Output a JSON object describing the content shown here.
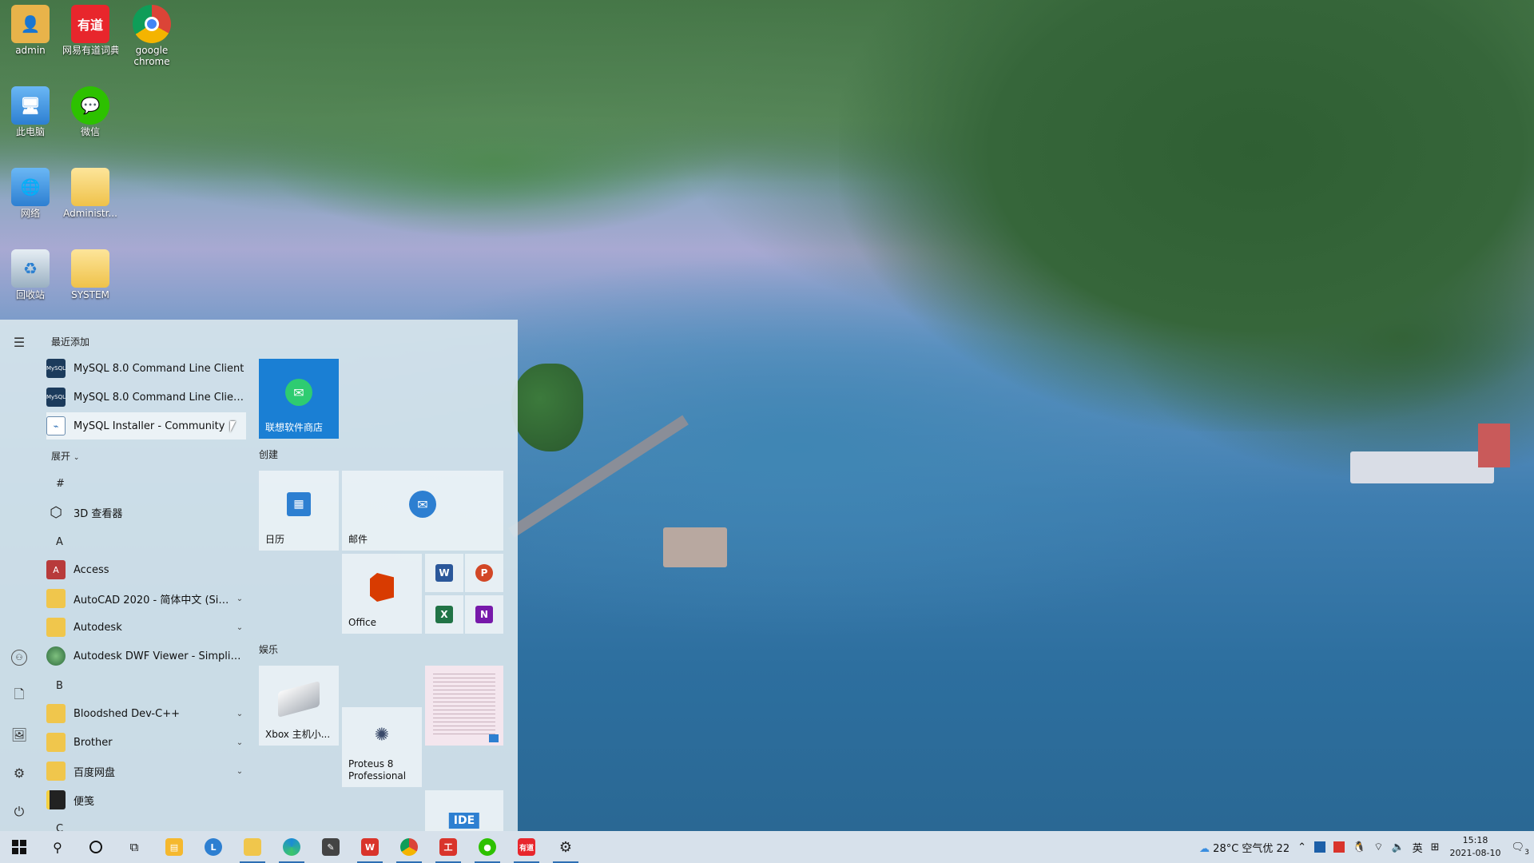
{
  "desktop": {
    "icons": [
      {
        "label": "admin",
        "icon": "user-folder-icon",
        "color": "#e8b34a"
      },
      {
        "label": "网易有道词典",
        "icon": "youdao-icon",
        "color": "#e8262c"
      },
      {
        "label": "google chrome",
        "icon": "chrome-icon",
        "color": "#4285f4"
      },
      {
        "label": "此电脑",
        "icon": "computer-icon",
        "color": "#3a8ee0"
      },
      {
        "label": "微信",
        "icon": "wechat-icon",
        "color": "#2dc100"
      },
      {
        "label": "网络",
        "icon": "network-icon",
        "color": "#3a8ee0"
      },
      {
        "label": "Administr...",
        "icon": "folder-icon",
        "color": "#f0c64c"
      },
      {
        "label": "回收站",
        "icon": "recycle-bin-icon",
        "color": "#9ab0c2"
      },
      {
        "label": "SYSTEM",
        "icon": "folder-icon",
        "color": "#f0c64c"
      }
    ]
  },
  "start_menu": {
    "recent_title": "最近添加",
    "recent": [
      {
        "label": "MySQL 8.0 Command Line Client",
        "icon": "mysql-icon"
      },
      {
        "label": "MySQL 8.0 Command Line Client -...",
        "icon": "mysql-icon"
      },
      {
        "label": "MySQL Installer - Community",
        "icon": "mysql-installer-icon"
      }
    ],
    "expand_label": "展开",
    "letter_hash": "#",
    "app_3d": "3D 查看器",
    "letter_a": "A",
    "apps_a": [
      {
        "label": "Access",
        "icon": "access-icon",
        "color": "#b83b3b",
        "chevron": false
      },
      {
        "label": "AutoCAD 2020 - 简体中文 (Sim...",
        "icon": "folder-icon",
        "color": "#f0c64c",
        "chevron": true
      },
      {
        "label": "Autodesk",
        "icon": "folder-icon",
        "color": "#f0c64c",
        "chevron": true
      },
      {
        "label": "Autodesk DWF Viewer - Simplified...",
        "icon": "dwf-viewer-icon",
        "color": "#3a8a4a",
        "chevron": false
      }
    ],
    "letter_b": "B",
    "apps_b": [
      {
        "label": "Bloodshed Dev-C++",
        "icon": "folder-icon",
        "color": "#f0c64c",
        "chevron": true
      },
      {
        "label": "Brother",
        "icon": "folder-icon",
        "color": "#f0c64c",
        "chevron": true
      },
      {
        "label": "百度网盘",
        "icon": "folder-icon",
        "color": "#f0c64c",
        "chevron": true
      },
      {
        "label": "便笺",
        "icon": "sticky-notes-icon",
        "color": "#222222",
        "chevron": false
      }
    ],
    "letter_c": "C",
    "tiles": {
      "store": "联想软件商店",
      "group_create": "创建",
      "calendar": "日历",
      "mail": "邮件",
      "office": "Office",
      "group_play": "娱乐",
      "xbox": "Xbox 主机小...",
      "proteus": "Proteus 8 Professional",
      "ide_tile": "IDE"
    }
  },
  "taskbar": {
    "weather": "28°C 空气优 22",
    "lang": "英",
    "time": "15:18",
    "date": "2021-08-10",
    "notification_count": "3",
    "accent": "#2d6fb4"
  }
}
